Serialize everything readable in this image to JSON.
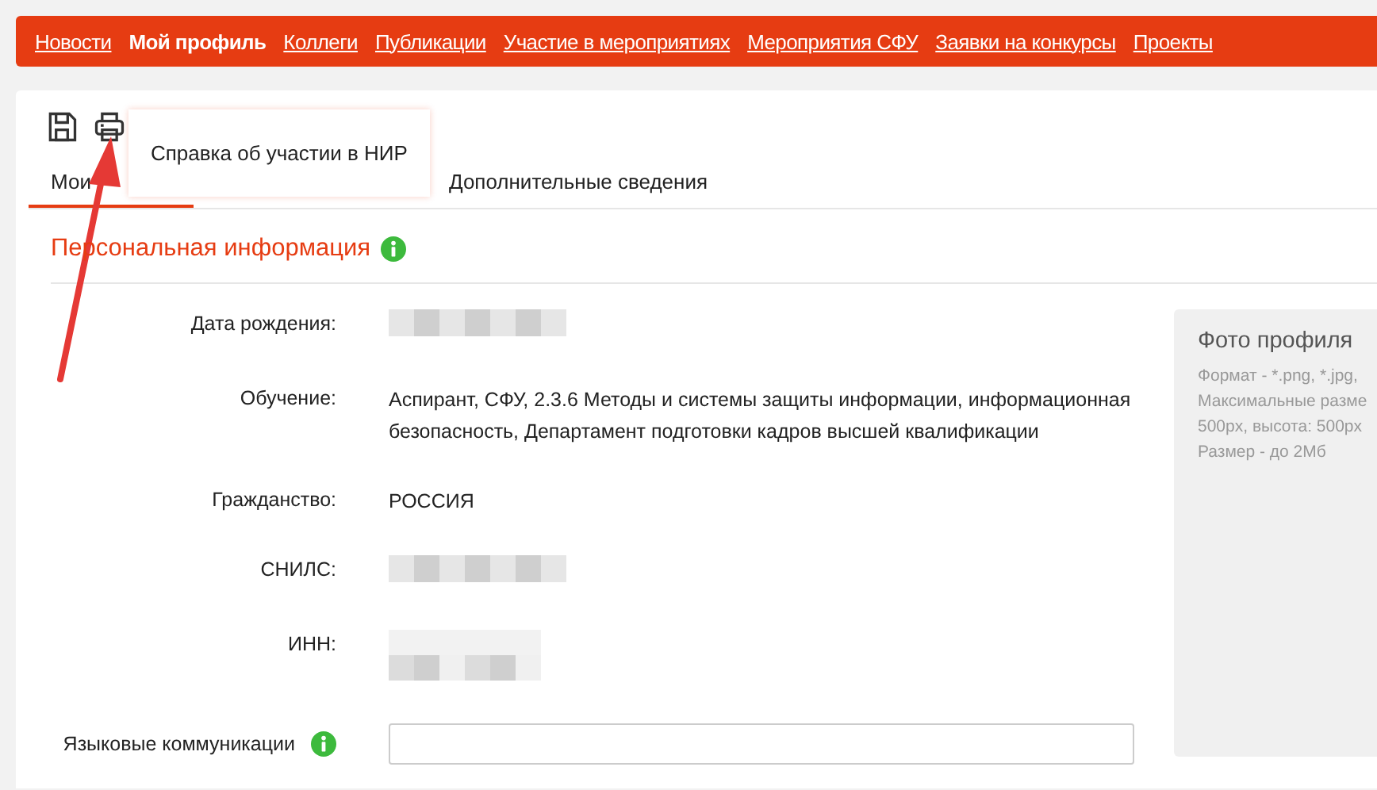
{
  "nav": [
    {
      "label": "Новости",
      "selected": false
    },
    {
      "label": "Мой профиль",
      "selected": true
    },
    {
      "label": "Коллеги",
      "selected": false
    },
    {
      "label": "Публикации",
      "selected": false
    },
    {
      "label": "Участие в мероприятиях",
      "selected": false
    },
    {
      "label": "Мероприятия СФУ",
      "selected": false
    },
    {
      "label": "Заявки на конкурсы",
      "selected": false
    },
    {
      "label": "Проекты",
      "selected": false
    }
  ],
  "tooltip": "Справка об участии в НИР",
  "tabs": [
    {
      "label": "Мои",
      "selected": true
    },
    {
      "label": "Дополнительные сведения",
      "selected": false
    }
  ],
  "section": {
    "title": "Персональная информация"
  },
  "fields": [
    {
      "label": "Дата рождения:",
      "kind": "blurred"
    },
    {
      "label": "Обучение:",
      "kind": "text",
      "value": "Аспирант, СФУ, 2.3.6 Методы и системы защиты информации, информационная безопасность, Департамент подготовки кадров высшей квалификации"
    },
    {
      "label": "Гражданство:",
      "kind": "text",
      "value": "РОССИЯ"
    },
    {
      "label": "СНИЛС:",
      "kind": "blurred"
    },
    {
      "label": "ИНН:",
      "kind": "blurred2"
    },
    {
      "label": "Языковые коммуникации",
      "kind": "input",
      "info": true
    }
  ],
  "photo": {
    "title": "Фото профиля",
    "lines": [
      "Формат - *.png, *.jpg,",
      "Максимальные разме",
      "500px, высота: 500px",
      "Размер - до 2Мб"
    ]
  }
}
